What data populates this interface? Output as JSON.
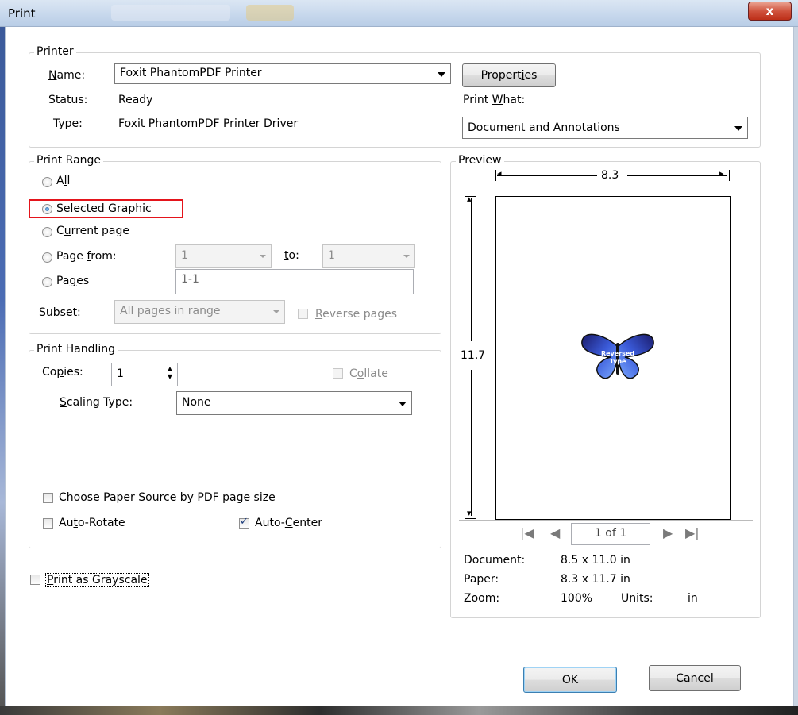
{
  "window": {
    "title": "Print",
    "close_glyph": "x"
  },
  "printer_group": {
    "legend": "Printer",
    "name_label": "Name:",
    "name_value": "Foxit PhantomPDF Printer",
    "properties_button": "Properties",
    "status_label": "Status:",
    "status_value": "Ready",
    "type_label": "Type:",
    "type_value": "Foxit PhantomPDF Printer Driver",
    "print_what_label": "Print What:",
    "print_what_value": "Document and Annotations"
  },
  "print_range": {
    "legend": "Print Range",
    "options": {
      "all": "All",
      "selected_graphic": "Selected Graphic",
      "current_page": "Current page",
      "page_from": "Page from:",
      "pages": "Pages"
    },
    "selected": "selected_graphic",
    "from_value": "1",
    "to_label": "to:",
    "to_value": "1",
    "pages_value": "1-1",
    "subset_label": "Subset:",
    "subset_value": "All pages in range",
    "reverse_pages": "Reverse pages"
  },
  "print_handling": {
    "legend": "Print Handling",
    "copies_label": "Copies:",
    "copies_value": "1",
    "collate": "Collate",
    "scaling_label": "Scaling Type:",
    "scaling_value": "None",
    "choose_paper_source": "Choose Paper Source by PDF page size",
    "auto_rotate": "Auto-Rotate",
    "auto_center": "Auto-Center",
    "auto_rotate_checked": false,
    "auto_center_checked": true
  },
  "grayscale": {
    "label": "Print as Grayscale",
    "checked": false
  },
  "preview": {
    "legend": "Preview",
    "width_dim": "8.3",
    "height_dim": "11.7",
    "butterfly_text_1": "Reversed",
    "butterfly_text_2": "Type",
    "page_indicator": "1 of 1",
    "document_label": "Document:",
    "document_value": "8.5 x 11.0 in",
    "paper_label": "Paper:",
    "paper_value": "8.3 x 11.7 in",
    "zoom_label": "Zoom:",
    "zoom_value": "100%",
    "units_label": "Units:",
    "units_value": "in"
  },
  "buttons": {
    "ok": "OK",
    "cancel": "Cancel"
  },
  "colors": {
    "highlight_box": "#e4141b",
    "titlebar": "#c6d7ec"
  }
}
